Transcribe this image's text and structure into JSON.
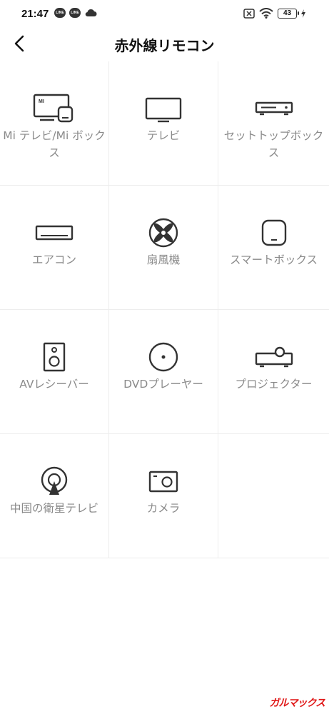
{
  "status_bar": {
    "time": "21:47",
    "line_badge_1": "LINE",
    "line_badge_2": "LINE",
    "battery": "43",
    "icons": [
      "line-icon",
      "line-icon",
      "cloud-icon",
      "sim-disabled-icon",
      "wifi-icon",
      "battery-icon",
      "charging-icon"
    ]
  },
  "header": {
    "title": "赤外線リモコン",
    "back_icon": "chevron-left-icon"
  },
  "devices": [
    {
      "label": "Mi テレビ/Mi ボックス",
      "icon": "mi-tv-box-icon",
      "mi_text": "MI"
    },
    {
      "label": "テレビ",
      "icon": "tv-icon"
    },
    {
      "label": "セットトップボックス",
      "icon": "set-top-box-icon"
    },
    {
      "label": "エアコン",
      "icon": "air-conditioner-icon"
    },
    {
      "label": "扇風機",
      "icon": "fan-icon"
    },
    {
      "label": "スマートボックス",
      "icon": "smart-box-icon"
    },
    {
      "label": "AVレシーバー",
      "icon": "speaker-icon"
    },
    {
      "label": "DVDプレーヤー",
      "icon": "disc-icon"
    },
    {
      "label": "プロジェクター",
      "icon": "projector-icon"
    },
    {
      "label": "中国の衛星テレビ",
      "icon": "satellite-icon"
    },
    {
      "label": "カメラ",
      "icon": "camera-icon"
    }
  ],
  "watermark": "ガルマックス",
  "colors": {
    "icon": "#333333",
    "label": "#8a8a8a",
    "divider": "#ededed",
    "watermark": "#e01818"
  }
}
